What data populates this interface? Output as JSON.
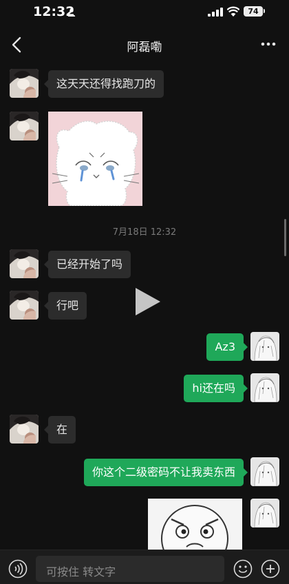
{
  "status_bar": {
    "time": "12:32",
    "battery": "74"
  },
  "header": {
    "title": "阿磊嘞"
  },
  "messages": {
    "m1": "这天天还得找跑刀的",
    "timestamp": "7月18日 12:32",
    "m3": "已经开始了吗",
    "m4": "行吧",
    "m5": "Az3",
    "m6": "hi还在吗",
    "m7": "在",
    "m8": "你这个二级密码不让我卖东西"
  },
  "input_bar": {
    "placeholder": "可按住 转文字"
  },
  "colors": {
    "background": "#111111",
    "bubble_in": "#2c2c2c",
    "bubble_out": "#1fa859"
  },
  "icons": [
    "person-icon",
    "signal-icon",
    "wifi-icon",
    "battery-icon",
    "back-icon",
    "more-icon",
    "play-icon",
    "voice-icon",
    "emoji-icon",
    "plus-icon"
  ]
}
